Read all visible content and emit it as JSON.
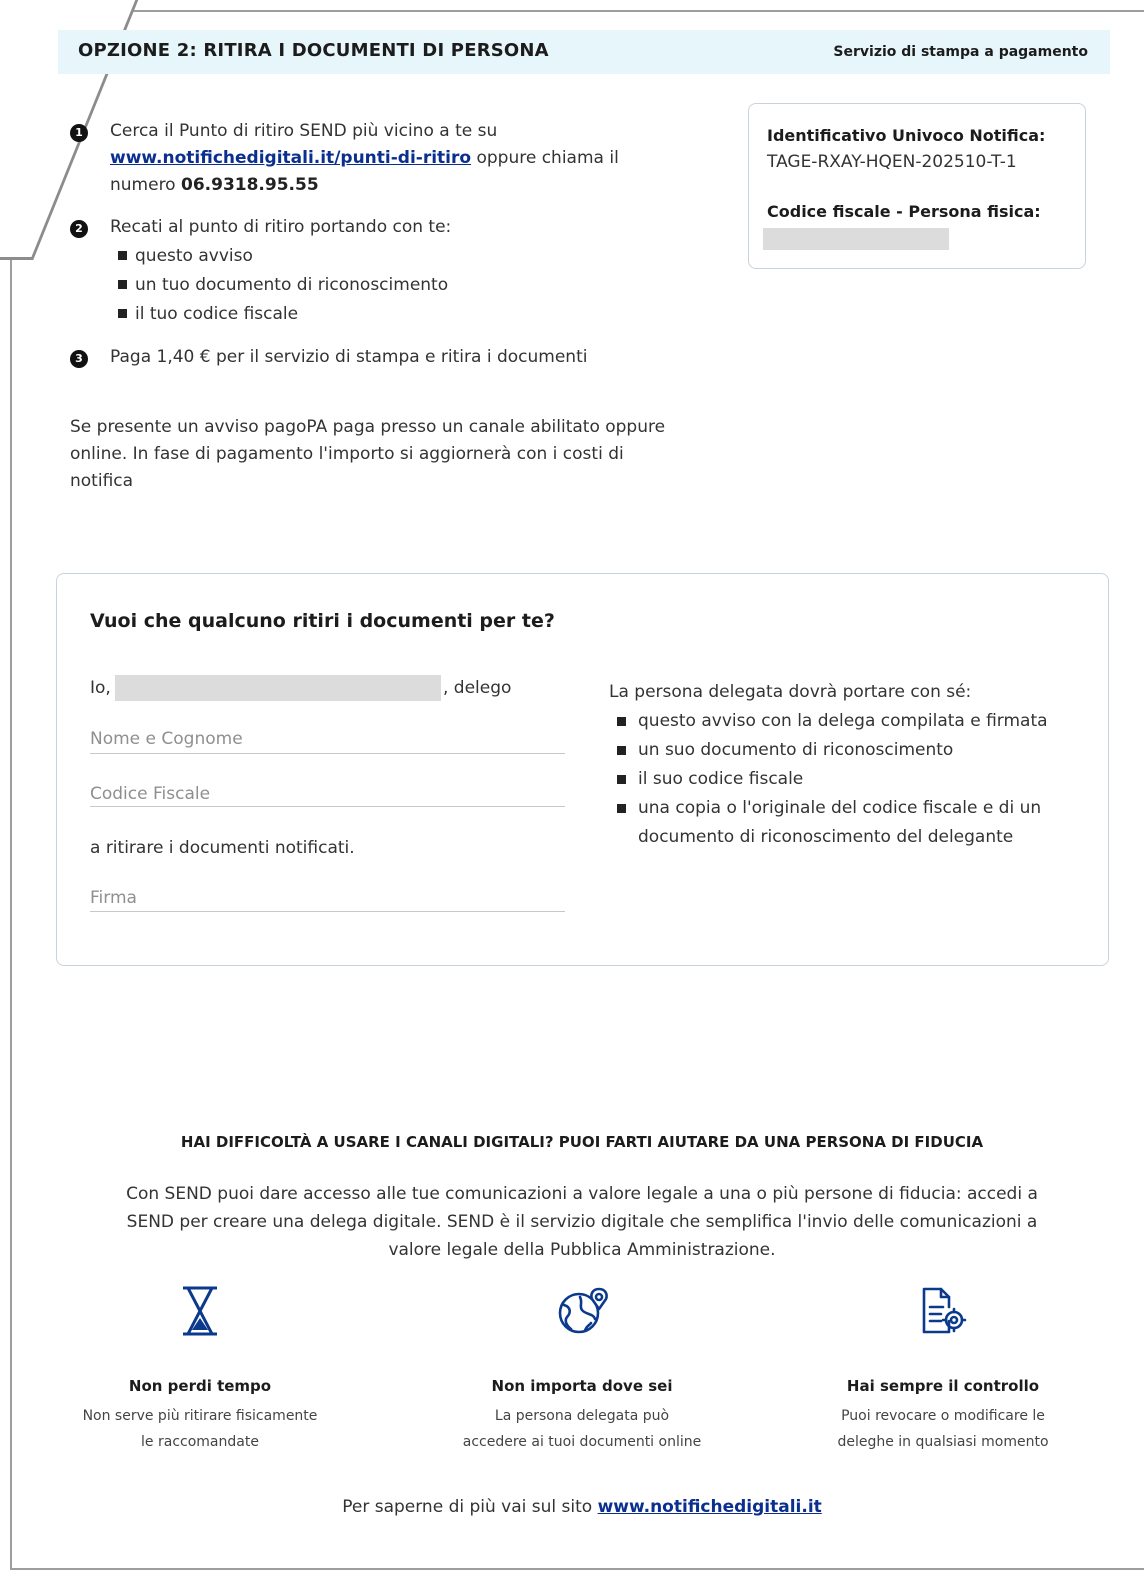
{
  "header": {
    "title": "OPZIONE 2: RITIRA I DOCUMENTI DI PERSONA",
    "right_label": "Servizio di stampa a pagamento"
  },
  "steps": [
    {
      "number": "1",
      "text_before": "Cerca il Punto di ritiro SEND più vicino a te su",
      "link": "www.notifichedigitali.it/punti-di-ritiro",
      "text_middle": " oppure chiama il numero ",
      "phone": "06.9318.95.55"
    },
    {
      "number": "2",
      "text": "Recati al punto di ritiro portando con te:",
      "bullets": [
        "questo avviso",
        "un tuo documento di riconoscimento",
        "il tuo codice fiscale"
      ]
    },
    {
      "number": "3",
      "text": "Paga 1,40 € per il servizio di stampa e ritira i documenti"
    }
  ],
  "info": {
    "iun_label": "Identificativo Univoco Notifica:",
    "iun_value": "TAGE-RXAY-HQEN-202510-T-1",
    "cf_label": "Codice fiscale - Persona fisica:"
  },
  "payment_note": "Se presente un avviso pagoPA paga presso un canale abilitato oppure online. In fase di pagamento l'importo si aggiornerà con i costi di notifica",
  "delega": {
    "title": "Vuoi che qualcuno ritiri i documenti per te?",
    "io_label": "Io,",
    "delego_label": ", delego",
    "name_placeholder": "Nome e Cognome",
    "cf_placeholder": "Codice Fiscale",
    "ritirare_text": "a ritirare i documenti notificati.",
    "firma_placeholder": "Firma",
    "right_title": "La persona delegata dovrà portare con sé:",
    "right_bullets": [
      "questo avviso con la delega compilata e firmata",
      "un suo documento di riconoscimento",
      "il suo codice fiscale",
      "una copia o l'originale del codice fiscale e di un documento di riconoscimento del delegante"
    ]
  },
  "help": {
    "title": "HAI DIFFICOLTÀ A USARE I CANALI DIGITALI? PUOI FARTI AIUTARE DA UNA PERSONA DI FIDUCIA",
    "text": "Con SEND puoi dare accesso alle tue comunicazioni a valore legale a una o più persone di fiducia: accedi a SEND per creare una delega digitale. SEND è il servizio digitale che semplifica l'invio delle comunicazioni a valore legale della Pubblica Amministrazione."
  },
  "features": [
    {
      "icon": "hourglass-icon",
      "title": "Non perdi tempo",
      "line1": "Non serve più ritirare fisicamente",
      "line2": "le raccomandate"
    },
    {
      "icon": "globe-location-icon",
      "title": "Non importa dove sei",
      "line1": "La persona delegata può",
      "line2": "accedere ai tuoi documenti online"
    },
    {
      "icon": "document-settings-icon",
      "title": "Hai sempre il controllo",
      "line1": "Puoi revocare o modificare le",
      "line2": "deleghe in qualsiasi momento"
    }
  ],
  "footer": {
    "text": "Per saperne di più vai sul sito ",
    "link": "www.notifichedigitali.it"
  },
  "colors": {
    "header_bg": "#e6f6fb",
    "link": "#0b2f8f",
    "icon_blue": "#0b3a8c",
    "redaction": "#dcdcdc"
  }
}
